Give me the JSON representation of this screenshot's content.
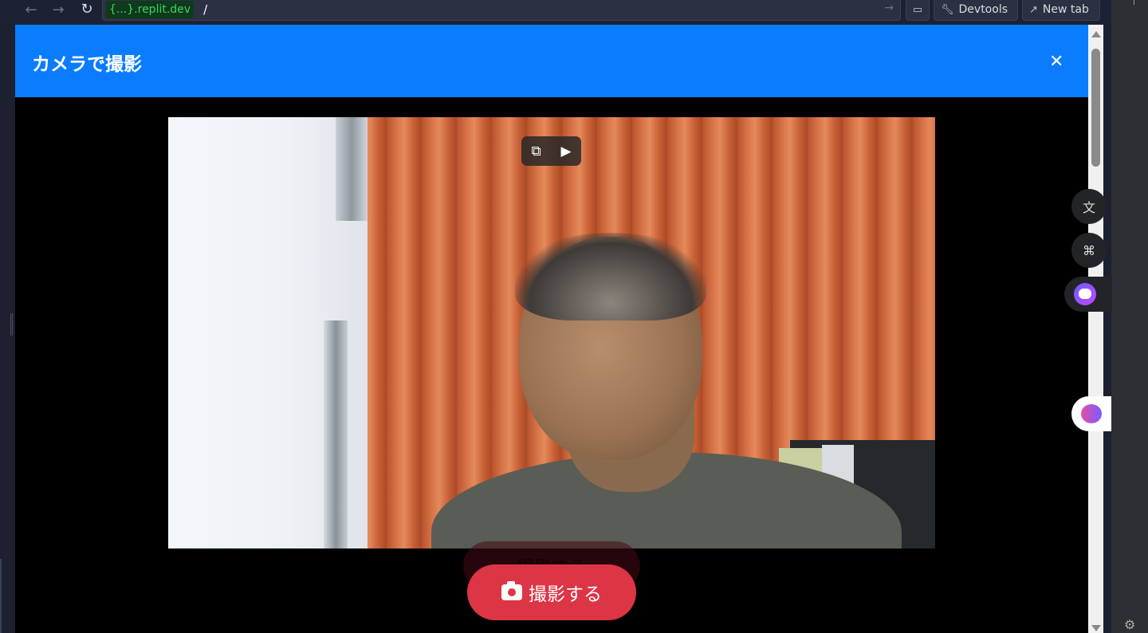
{
  "browser": {
    "url_domain_brace": "{...}",
    "url_domain": ".replit.dev",
    "url_path": "/",
    "devtools_label": "Devtools",
    "new_tab_label": "New tab"
  },
  "modal": {
    "title": "カメラで撮影",
    "close_glyph": "✕"
  },
  "capture": {
    "label": "撮影する",
    "ghost_label": "撮影する"
  },
  "icons": {
    "back": "arrow-left-icon",
    "forward": "arrow-right-icon",
    "reload": "reload-icon",
    "go": "arrow-right-icon",
    "device": "monitor-icon",
    "devtools": "wrench-icon",
    "new_tab": "external-link-icon",
    "pip_exit": "exit-pip-icon",
    "pip_ai": "video-sparkle-icon",
    "translate": "translate-icon",
    "apps": "apps-grid-icon",
    "assistant": "assistant-face-icon",
    "brain": "brain-icon",
    "settings": "gear-icon"
  },
  "colors": {
    "header": "#0a7cff",
    "capture_button": "#dc3545",
    "url_domain": "#3ed35f"
  }
}
